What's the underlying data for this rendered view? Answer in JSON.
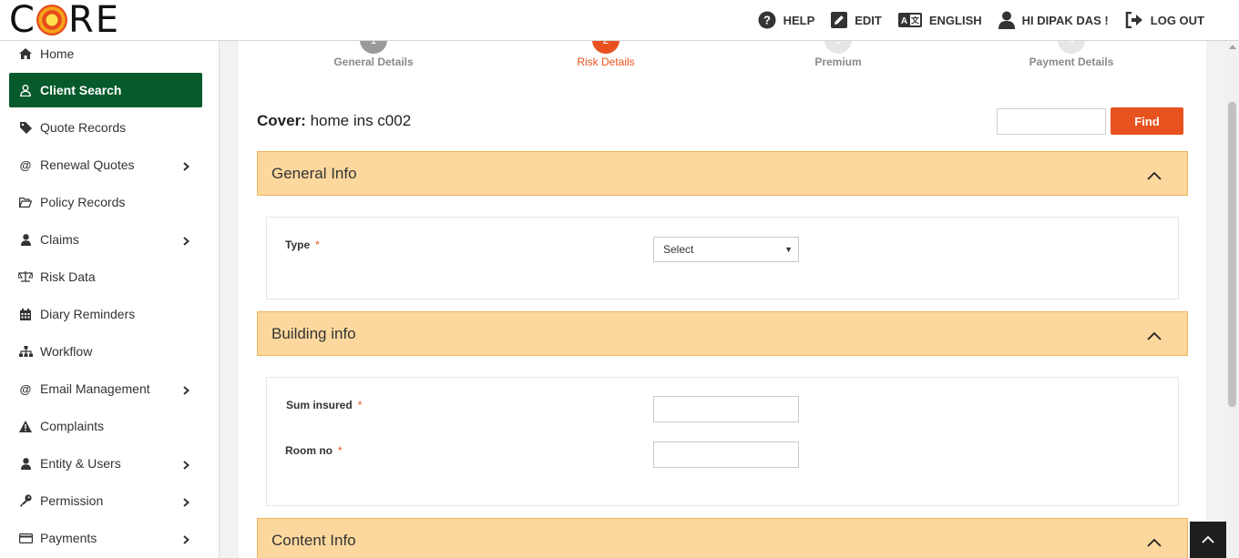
{
  "header": {
    "logo_text_left": "C",
    "logo_text_right": "RE",
    "nav": [
      {
        "label": "HELP",
        "icon": "help-icon"
      },
      {
        "label": "EDIT",
        "icon": "edit-icon"
      },
      {
        "label": "ENGLISH",
        "icon": "translate-icon"
      },
      {
        "label": "HI DIPAK DAS !",
        "icon": "user-icon"
      },
      {
        "label": "LOG OUT",
        "icon": "logout-icon"
      }
    ]
  },
  "sidebar": {
    "items": [
      {
        "label": "Home",
        "icon": "home-icon",
        "submenu": false
      },
      {
        "label": "Client Search",
        "icon": "user-outline-icon",
        "submenu": false,
        "active": true
      },
      {
        "label": "Quote Records",
        "icon": "tag-icon",
        "submenu": false
      },
      {
        "label": "Renewal Quotes",
        "icon": "at-icon",
        "submenu": true
      },
      {
        "label": "Policy Records",
        "icon": "folder-open-icon",
        "submenu": false
      },
      {
        "label": "Claims",
        "icon": "user-icon",
        "submenu": true
      },
      {
        "label": "Risk Data",
        "icon": "scale-icon",
        "submenu": false
      },
      {
        "label": "Diary Reminders",
        "icon": "calendar-icon",
        "submenu": false
      },
      {
        "label": "Workflow",
        "icon": "sitemap-icon",
        "submenu": false
      },
      {
        "label": "Email Management",
        "icon": "at-icon",
        "submenu": true
      },
      {
        "label": "Complaints",
        "icon": "warning-icon",
        "submenu": false
      },
      {
        "label": "Entity & Users",
        "icon": "user-icon",
        "submenu": true
      },
      {
        "label": "Permission",
        "icon": "key-icon",
        "submenu": true
      },
      {
        "label": "Payments",
        "icon": "credit-card-icon",
        "submenu": true
      }
    ]
  },
  "steps": [
    {
      "number": "1",
      "label": "General Details",
      "state": "done"
    },
    {
      "number": "2",
      "label": "Risk Details",
      "state": "current"
    },
    {
      "number": "3",
      "label": "Premium",
      "state": "future"
    },
    {
      "number": "4",
      "label": "Payment Details",
      "state": "future"
    }
  ],
  "cover": {
    "label": "Cover:",
    "value": "home ins c002"
  },
  "find": {
    "button_label": "Find",
    "input_value": ""
  },
  "sections": {
    "general": {
      "title": "General Info",
      "type_label": "Type",
      "type_value": "Select"
    },
    "building": {
      "title": "Building info",
      "sum_label": "Sum insured",
      "room_label": "Room no"
    },
    "content": {
      "title": "Content Info"
    }
  },
  "required_marker": "*",
  "colors": {
    "accent": "#e8521f",
    "active_nav": "#075a2c",
    "section_header": "#fdd89e"
  }
}
